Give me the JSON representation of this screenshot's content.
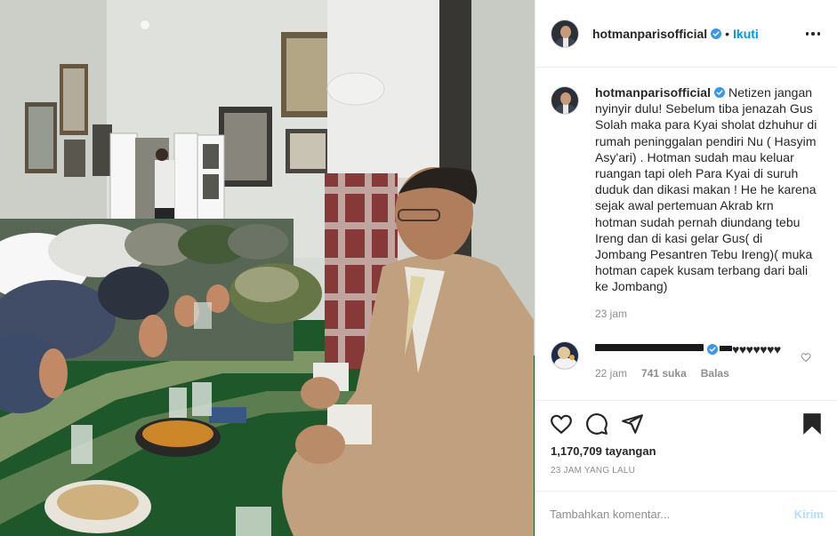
{
  "post": {
    "username": "hotmanparisofficial",
    "follow_label": "Ikuti",
    "separator": "•"
  },
  "caption": {
    "username": "hotmanparisofficial",
    "text": " Netizen jangan nyinyir dulu! Sebelum tiba jenazah Gus Solah maka para Kyai sholat dzhuhur di rumah peninggalan pendiri Nu ( Hasyim Asy'ari) . Hotman sudah mau keluar ruangan tapi oleh Para Kyai di suruh duduk dan dikasi makan ! He he karena sejak awal pertemuan Akrab krn hotman sudah pernah diundang tebu Ireng dan di kasi gelar Gus( di Jombang Pesantren Tebu Ireng)( muka hotman capek kusam terbang dari bali ke Jombang)",
    "time": "23 jam"
  },
  "comment": {
    "hearts": "♥♥♥♥♥♥♥",
    "time": "22 jam",
    "likes": "741 suka",
    "reply_label": "Balas"
  },
  "stats": {
    "views": "1,170,709 tayangan",
    "time_ago": "23 JAM YANG LALU"
  },
  "add_comment": {
    "placeholder": "Tambahkan komentar...",
    "post_label": "Kirim"
  },
  "colors": {
    "link_blue": "#0095f6",
    "verified_blue": "#3897f0",
    "muted": "#8e8e8e",
    "post_disabled": "#b2dffc"
  },
  "icons": [
    "verified-badge-icon",
    "more-options-icon",
    "heart-icon",
    "comment-icon",
    "share-icon",
    "bookmark-icon"
  ]
}
